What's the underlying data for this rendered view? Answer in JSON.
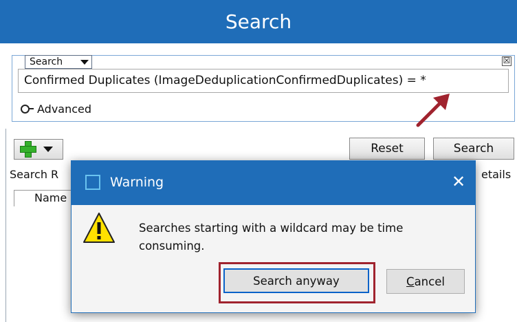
{
  "header": {
    "title": "Search"
  },
  "criteria": {
    "dropdown_label": "Search",
    "close_glyph": "☒",
    "query_text": "Confirmed Duplicates (ImageDeduplicationConfirmedDuplicates) = *",
    "advanced_label": "Advanced"
  },
  "toolbar": {
    "reset_label": "Reset",
    "search_label": "Search"
  },
  "results": {
    "label": "Search R",
    "details_label": "etails",
    "name_column": "Name"
  },
  "dialog": {
    "title": "Warning",
    "close_glyph": "✕",
    "message": "Searches starting with a wildcard may be time consuming.",
    "primary_button": "Search anyway",
    "cancel_first_letter": "C",
    "cancel_rest": "ancel"
  },
  "colors": {
    "header_blue": "#1f6db8",
    "annotation_red": "#a0232e",
    "warning_yellow": "#ffe100"
  },
  "icons": {
    "add": "plus-icon",
    "advanced": "key-icon",
    "warning": "warning-triangle-icon",
    "dialog_app": "window-icon",
    "close": "close-icon"
  }
}
